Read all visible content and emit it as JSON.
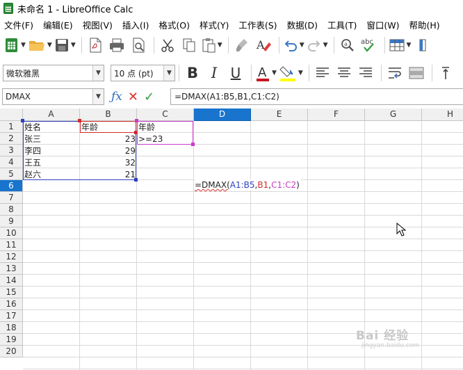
{
  "window": {
    "title": "未命名 1 - LibreOffice Calc"
  },
  "menu": [
    "文件(F)",
    "编辑(E)",
    "视图(V)",
    "插入(I)",
    "格式(O)",
    "样式(Y)",
    "工作表(S)",
    "数据(D)",
    "工具(T)",
    "窗口(W)",
    "帮助(H)"
  ],
  "formatting": {
    "font_name": "微软雅黑",
    "font_size": "10 点 (pt)",
    "bold": "B",
    "italic": "I",
    "underline": "U",
    "font_color_glyph": "A"
  },
  "formula_bar": {
    "name_box": "DMAX",
    "formula": "=DMAX(A1:B5,B1,C1:C2)"
  },
  "columns": [
    "A",
    "B",
    "C",
    "D",
    "E",
    "F",
    "G",
    "H"
  ],
  "active_column": "D",
  "active_row": "6",
  "rows": [
    "1",
    "2",
    "3",
    "4",
    "5",
    "6",
    "7",
    "8",
    "9",
    "10",
    "11",
    "12",
    "13",
    "14",
    "15",
    "16",
    "17",
    "18",
    "19",
    "20"
  ],
  "cells": {
    "A1": "姓名",
    "B1": "年龄",
    "C1": "年龄",
    "A2": "张三",
    "B2": "23",
    "C2": ">=23",
    "A3": "李四",
    "B3": "29",
    "A4": "王五",
    "B4": "32",
    "A5": "赵六",
    "B5": "21"
  },
  "editing_formula": {
    "prefix": "=DMAX(",
    "ref1": "A1:B5",
    "comma1": ",",
    "ref2": "B1",
    "comma2": ",",
    "ref3": "C1:C2",
    "suffix": ")"
  },
  "ref_colors": {
    "ref1": "#2b3fbf",
    "ref2": "#d22a2a",
    "ref3": "#c83cc8"
  },
  "watermark": {
    "text": "Bai 经验",
    "sub": "jingyan.baidu.com"
  }
}
